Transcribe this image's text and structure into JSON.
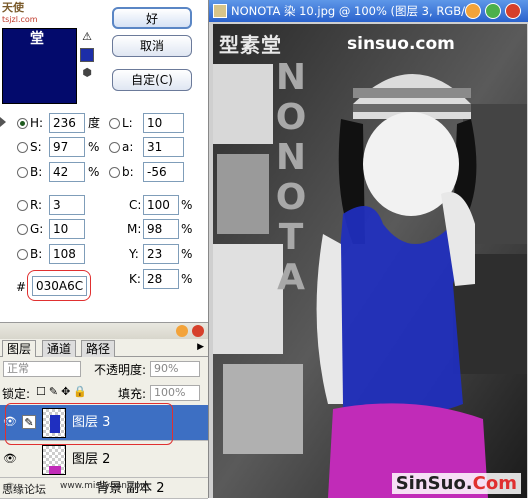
{
  "picker": {
    "watermark_corner": "天使",
    "watermark_corner_2": "堂",
    "watermark_url": "tsjzl.com",
    "current_color": "#030A6C",
    "buttons": {
      "ok": "好",
      "cancel": "取消",
      "custom": "自定(C)"
    },
    "hsb": [
      {
        "key": "H",
        "label": "H:",
        "value": "236",
        "unit": "度",
        "selected": true
      },
      {
        "key": "S",
        "label": "S:",
        "value": "97",
        "unit": "%",
        "selected": false
      },
      {
        "key": "B",
        "label": "B:",
        "value": "42",
        "unit": "%",
        "selected": false
      }
    ],
    "lab": [
      {
        "key": "L",
        "label": "L:",
        "value": "10"
      },
      {
        "key": "a",
        "label": "a:",
        "value": "31"
      },
      {
        "key": "b",
        "label": "b:",
        "value": "-56"
      }
    ],
    "rgb": [
      {
        "key": "R",
        "label": "R:",
        "value": "3"
      },
      {
        "key": "G",
        "label": "G:",
        "value": "10"
      },
      {
        "key": "B",
        "label": "B:",
        "value": "108"
      }
    ],
    "cmyk": [
      {
        "key": "C",
        "label": "C:",
        "value": "100",
        "unit": "%"
      },
      {
        "key": "M",
        "label": "M:",
        "value": "98",
        "unit": "%"
      },
      {
        "key": "Y",
        "label": "Y:",
        "value": "23",
        "unit": "%"
      },
      {
        "key": "K",
        "label": "K:",
        "value": "28",
        "unit": "%"
      }
    ],
    "hex_label": "#",
    "hex_value": "030A6C"
  },
  "layers_panel": {
    "tabs": [
      "图层",
      "通道",
      "路径"
    ],
    "blend_mode": "正常",
    "opacity_label": "不透明度:",
    "opacity_value": "90%",
    "lock_label": "锁定:",
    "fill_label": "填充:",
    "fill_value": "100%",
    "layers": [
      {
        "name": "图层 3",
        "active": true,
        "visible": true
      },
      {
        "name": "图层 2",
        "active": false,
        "visible": true
      },
      {
        "name": "背景 副本 2",
        "active": false,
        "visible": true
      }
    ],
    "footer_watermark": "思缘论坛",
    "footer_url": "www.missyuan.com"
  },
  "document": {
    "title": "NONOTA 染 10.jpg @ 100% (图层 3, RGB/...",
    "watermark_cn": "型素堂",
    "watermark_site": "sinsuo.com",
    "vertical_text": "NONOTA",
    "bottom_watermark_a": "SinSuo.",
    "bottom_watermark_b": "Com",
    "colors": {
      "titlebar": "#2a62cc",
      "paint_blue": "#1f2fc0",
      "paint_magenta": "#c12bb8"
    }
  }
}
